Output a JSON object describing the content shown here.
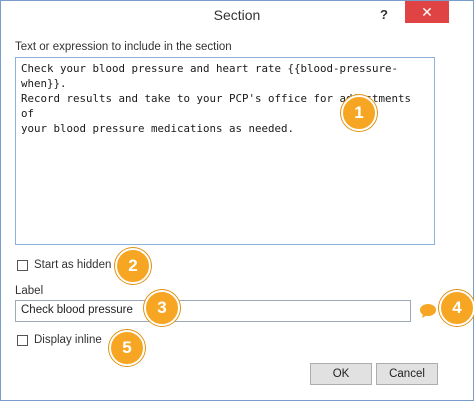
{
  "window": {
    "title": "Section",
    "help_label": "?",
    "close_label": "✕"
  },
  "section": {
    "text_label": "Text or expression to include in the section",
    "text_value": "Check your blood pressure and heart rate {{blood-pressure-when}}.\nRecord results and take to your PCP's office for adjustments of\nyour blood pressure medications as needed.",
    "start_hidden_label": "Start as hidden",
    "start_hidden_checked": false,
    "label_caption": "Label",
    "label_value": "Check blood pressure",
    "display_inline_label": "Display inline",
    "display_inline_checked": false
  },
  "buttons": {
    "ok": "OK",
    "cancel": "Cancel"
  },
  "callouts": [
    "1",
    "2",
    "3",
    "4",
    "5"
  ],
  "colors": {
    "callout": "#f6a623",
    "close": "#e04343",
    "comment_icon": "#f6a623"
  },
  "icons": {
    "comment": "speech-bubble-icon"
  }
}
